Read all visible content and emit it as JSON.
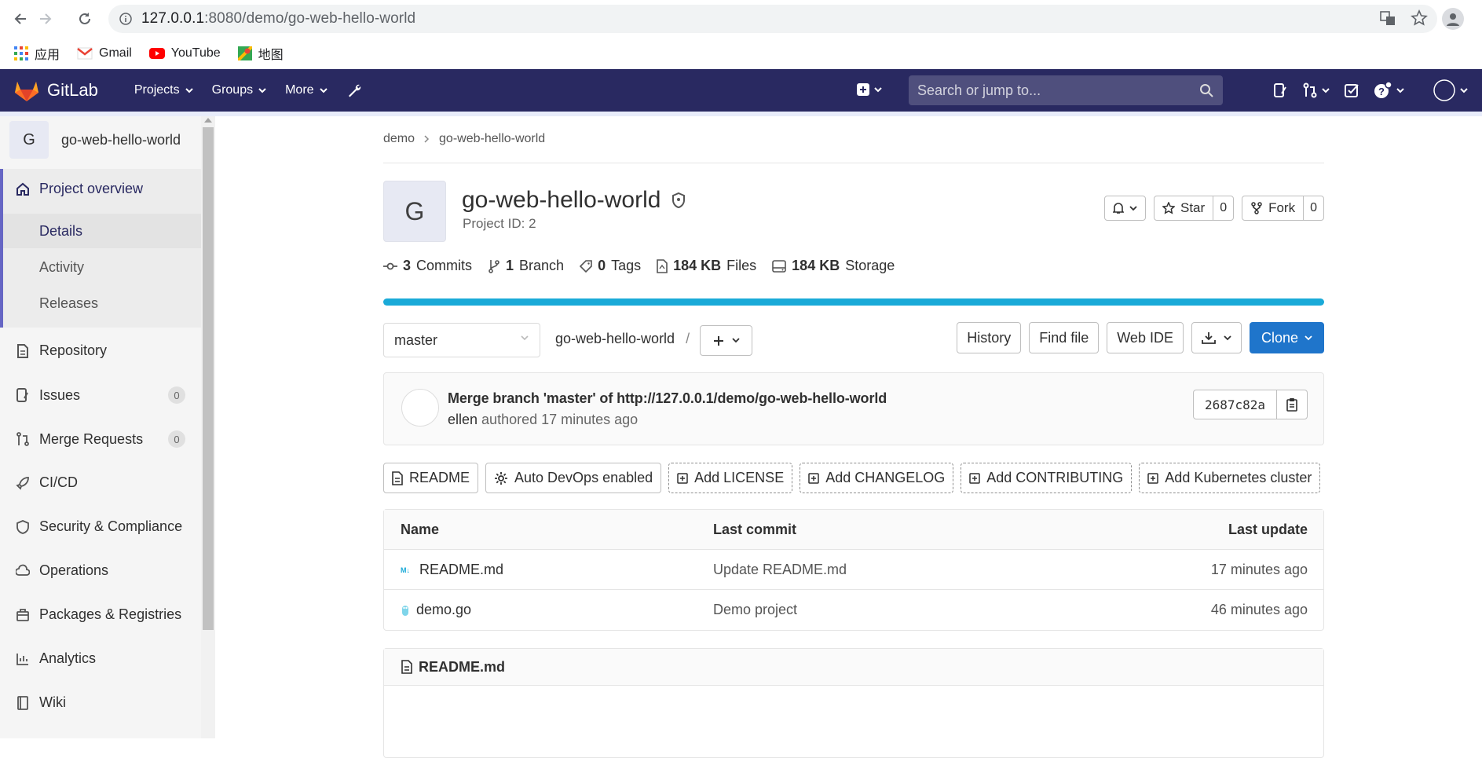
{
  "browser": {
    "url_host": "127.0.0.1",
    "url_rest": ":8080/demo/go-web-hello-world",
    "bookmarks": [
      {
        "label": "应用"
      },
      {
        "label": "Gmail"
      },
      {
        "label": "YouTube"
      },
      {
        "label": "地图"
      }
    ]
  },
  "header": {
    "brand": "GitLab",
    "nav": [
      "Projects",
      "Groups",
      "More"
    ],
    "search_placeholder": "Search or jump to..."
  },
  "sidebar": {
    "project_initial": "G",
    "project_name": "go-web-hello-world",
    "overview": "Project overview",
    "sub_items": [
      "Details",
      "Activity",
      "Releases"
    ],
    "items": [
      {
        "label": "Repository"
      },
      {
        "label": "Issues",
        "count": "0"
      },
      {
        "label": "Merge Requests",
        "count": "0"
      },
      {
        "label": "CI/CD"
      },
      {
        "label": "Security & Compliance"
      },
      {
        "label": "Operations"
      },
      {
        "label": "Packages & Registries"
      },
      {
        "label": "Analytics"
      },
      {
        "label": "Wiki"
      }
    ]
  },
  "breadcrumb": [
    "demo",
    "go-web-hello-world"
  ],
  "project": {
    "initial": "G",
    "title": "go-web-hello-world",
    "id_text": "Project ID: 2",
    "star_label": "Star",
    "star_count": "0",
    "fork_label": "Fork",
    "fork_count": "0"
  },
  "stats": {
    "commits_n": "3",
    "commits_label": "Commits",
    "branch_n": "1",
    "branch_label": "Branch",
    "tags_n": "0",
    "tags_label": "Tags",
    "files_n": "184 KB",
    "files_label": "Files",
    "storage_n": "184 KB",
    "storage_label": "Storage"
  },
  "repo": {
    "branch": "master",
    "path": "go-web-hello-world",
    "path_sep": "/",
    "buttons": {
      "history": "History",
      "find": "Find file",
      "webide": "Web IDE",
      "clone": "Clone"
    }
  },
  "commit": {
    "title": "Merge branch 'master' of http://127.0.0.1/demo/go-web-hello-world",
    "author": "ellen",
    "meta": "authored 17 minutes ago",
    "sha": "2687c82a"
  },
  "quick_actions": {
    "readme": "README",
    "autodevops": "Auto DevOps enabled",
    "license": "Add LICENSE",
    "changelog": "Add CHANGELOG",
    "contributing": "Add CONTRIBUTING",
    "kubernetes": "Add Kubernetes cluster"
  },
  "files": {
    "headers": {
      "name": "Name",
      "commit": "Last commit",
      "date": "Last update"
    },
    "rows": [
      {
        "name": "README.md",
        "commit": "Update README.md",
        "date": "17 minutes ago"
      },
      {
        "name": "demo.go",
        "commit": "Demo project",
        "date": "46 minutes ago"
      }
    ]
  },
  "readme": {
    "title": "README.md"
  },
  "colors": {
    "header_bg": "#292961",
    "accent": "#6666c4",
    "progress": "#1aaad8",
    "primary": "#1f75cb"
  }
}
